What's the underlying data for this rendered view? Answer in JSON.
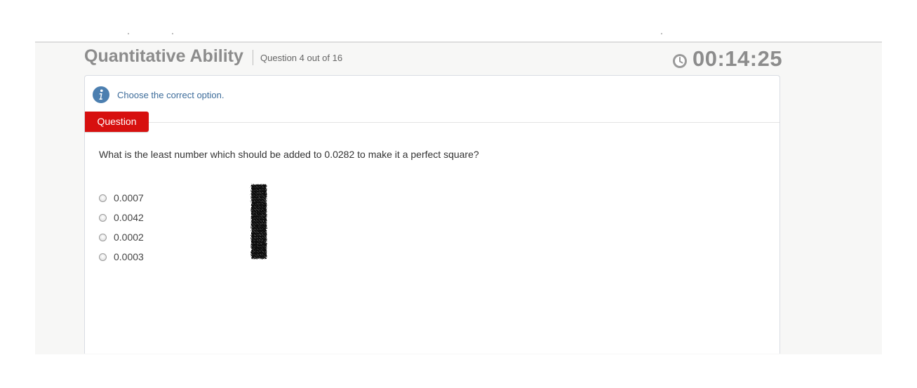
{
  "header": {
    "section_title": "Quantitative Ability",
    "question_count": "Question 4 out of 16",
    "timer": "00:14:25",
    "timer_icon": "clock-icon"
  },
  "panel": {
    "info_icon": "info-icon",
    "instruction": "Choose the correct option.",
    "tab_label": "Question",
    "question": "What is the least number which should be added to 0.0282 to make it a perfect square?",
    "options": [
      {
        "label": "0.0007",
        "selected": false
      },
      {
        "label": "0.0042",
        "selected": false
      },
      {
        "label": "0.0002",
        "selected": false
      },
      {
        "label": "0.0003",
        "selected": false
      }
    ]
  },
  "colors": {
    "tab_red": "#d7100f",
    "info_blue": "#3d6c9a",
    "header_gray": "#8c8c8c"
  }
}
